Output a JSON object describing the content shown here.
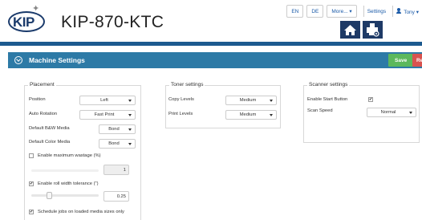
{
  "header": {
    "logo_text": "KIP",
    "title": "KIP-870-KTC",
    "nav": {
      "lang_en": "EN",
      "lang_de": "DE",
      "more": "More... ▾",
      "settings": "Settings",
      "user": "Tony ▾"
    },
    "tabs": [
      {
        "icon": "home-icon",
        "active": false
      },
      {
        "icon": "printer-settings-icon",
        "active": true
      }
    ]
  },
  "panel": {
    "title": "Machine Settings",
    "save_label": "Save",
    "reset_label": "Reset"
  },
  "placement": {
    "legend": "Placement",
    "position_label": "Position",
    "position_value": "Left",
    "auto_rotation_label": "Auto Rotation",
    "auto_rotation_value": "Fast Print",
    "default_bw_label": "Default B&W Media",
    "default_bw_value": "Bond",
    "default_color_label": "Default Color Media",
    "default_color_value": "Bond",
    "max_wastage_label": "Enable maximum wastage (%)",
    "max_wastage_checked": false,
    "max_wastage_value": "1",
    "roll_width_label": "Enable roll width tolerance (\")",
    "roll_width_checked": true,
    "roll_width_value": "0.25",
    "roll_width_slider_fraction": 0.25,
    "schedule_label": "Schedule jobs on loaded media sizes only",
    "schedule_checked": true
  },
  "toner": {
    "legend": "Toner settings",
    "copy_levels_label": "Copy Levels",
    "copy_levels_value": "Medium",
    "print_levels_label": "Print Levels",
    "print_levels_value": "Medium"
  },
  "scanner": {
    "legend": "Scanner settings",
    "enable_start_label": "Enable Start Button",
    "enable_start_checked": true,
    "scan_speed_label": "Scan Speed",
    "scan_speed_value": "Normal"
  },
  "colors": {
    "nav_dark": "#1e3a66",
    "bar_blue": "#1c5a8f",
    "panel_header": "#2d7aa6",
    "save_green": "#5cb85c",
    "reset_red": "#d9534f"
  }
}
